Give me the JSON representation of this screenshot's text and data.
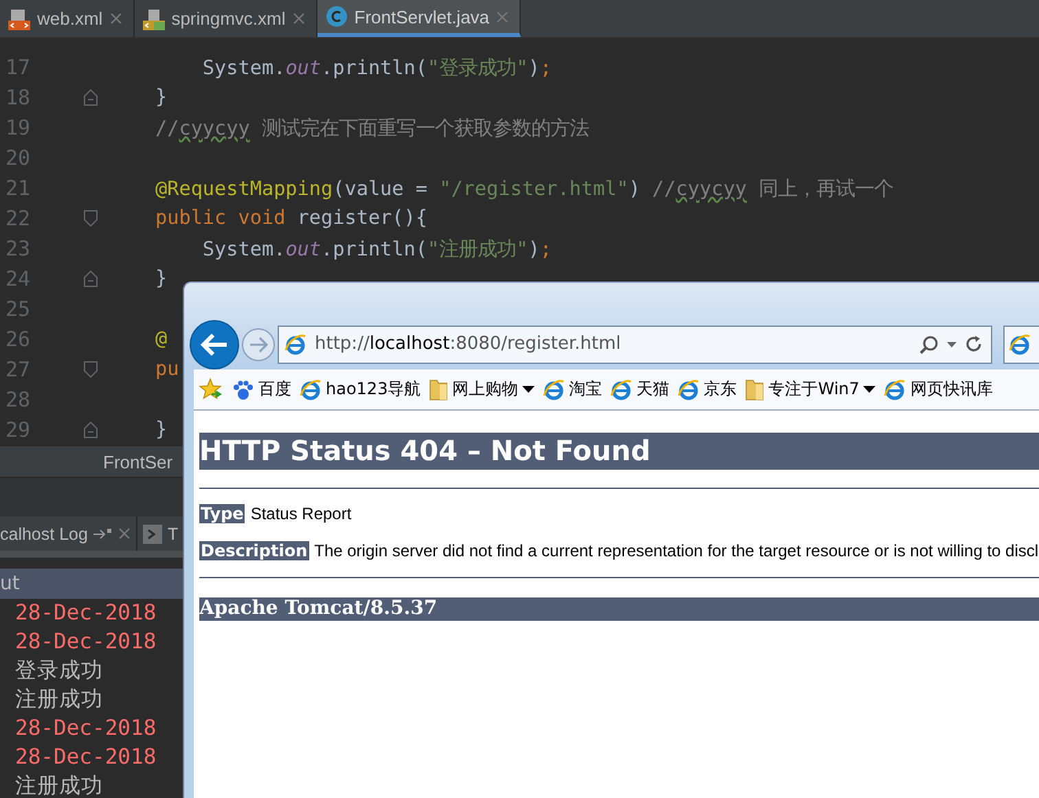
{
  "editor_tabs": [
    {
      "kind": "xml",
      "label": "web.xml",
      "selected": false
    },
    {
      "kind": "spring-xml",
      "label": "springmvc.xml",
      "selected": false
    },
    {
      "kind": "class",
      "label": "FrontServlet.java",
      "selected": true
    }
  ],
  "editor": {
    "lines": [
      {
        "number": "17",
        "kind": "plain",
        "code": [
          {
            "kind": "plain",
            "text": "    System."
          },
          {
            "kind": "static",
            "text": "out"
          },
          {
            "kind": "plain",
            "text": ".println("
          },
          {
            "kind": "string",
            "text": "\"登录成功\""
          },
          {
            "kind": "plain",
            "text": ")"
          },
          {
            "kind": "keyword",
            "text": ";"
          }
        ]
      },
      {
        "number": "18",
        "kind": "fold-end",
        "code": [
          {
            "kind": "plain",
            "text": "}"
          }
        ]
      },
      {
        "number": "19",
        "kind": "plain",
        "code": [
          {
            "kind": "comment",
            "text": "//"
          },
          {
            "kind": "comment-typo",
            "text": "cyycyy"
          },
          {
            "kind": "comment",
            "text": " 测试完在下面重写一个获取参数的方法"
          }
        ]
      },
      {
        "number": "20",
        "kind": "plain"
      },
      {
        "number": "21",
        "kind": "plain",
        "code": [
          {
            "kind": "annotation",
            "text": "@RequestMapping"
          },
          {
            "kind": "plain",
            "text": "(value = "
          },
          {
            "kind": "string",
            "text": "\"/register.html\""
          },
          {
            "kind": "plain",
            "text": ") "
          },
          {
            "kind": "comment",
            "text": "//"
          },
          {
            "kind": "comment-typo",
            "text": "cyycyy"
          },
          {
            "kind": "comment",
            "text": " 同上，再试一个"
          }
        ]
      },
      {
        "number": "22",
        "kind": "fold-start",
        "code": [
          {
            "kind": "keyword",
            "text": "public void "
          },
          {
            "kind": "plain",
            "text": "register(){"
          }
        ]
      },
      {
        "number": "23",
        "kind": "plain",
        "code": [
          {
            "kind": "plain",
            "text": "    System."
          },
          {
            "kind": "static",
            "text": "out"
          },
          {
            "kind": "plain",
            "text": ".println("
          },
          {
            "kind": "string",
            "text": "\"注册成功\""
          },
          {
            "kind": "plain",
            "text": ")"
          },
          {
            "kind": "keyword",
            "text": ";"
          }
        ]
      },
      {
        "number": "24",
        "kind": "fold-end",
        "code": [
          {
            "kind": "plain",
            "text": "}"
          }
        ]
      },
      {
        "number": "25",
        "kind": "plain"
      },
      {
        "number": "26",
        "kind": "plain",
        "code": [
          {
            "kind": "annotation",
            "text": "@"
          }
        ]
      },
      {
        "number": "27",
        "kind": "fold-start",
        "code": [
          {
            "kind": "keyword",
            "text": "pu"
          }
        ]
      },
      {
        "number": "28",
        "kind": "plain"
      },
      {
        "number": "29",
        "kind": "fold-end",
        "code": [
          {
            "kind": "plain",
            "text": "}"
          }
        ]
      }
    ]
  },
  "file_status": {
    "label": "FrontSer"
  },
  "tool_tabs": [
    {
      "label": "calhost Log",
      "selected": true
    },
    {
      "label": "T",
      "selected": false
    }
  ],
  "output_header": {
    "label": "ut"
  },
  "console_lines": [
    {
      "kind": "log",
      "text": "28-Dec-2018"
    },
    {
      "kind": "log",
      "text": "28-Dec-2018"
    },
    {
      "kind": "out",
      "text": "登录成功"
    },
    {
      "kind": "out",
      "text": "注册成功"
    },
    {
      "kind": "log",
      "text": "28-Dec-2018"
    },
    {
      "kind": "log",
      "text": "28-Dec-2018"
    },
    {
      "kind": "out",
      "text": "注册成功"
    }
  ],
  "browser": {
    "address": {
      "prefix": "http://",
      "host": "localhost",
      "rest": ":8080/register.html"
    },
    "favorites": [
      {
        "kind": "baidu",
        "label": "百度",
        "menu": false
      },
      {
        "kind": "page",
        "label": "hao123导航",
        "menu": false
      },
      {
        "kind": "folder",
        "label": "网上购物",
        "menu": true
      },
      {
        "kind": "page",
        "label": "淘宝",
        "menu": false
      },
      {
        "kind": "page",
        "label": "天猫",
        "menu": false
      },
      {
        "kind": "page",
        "label": "京东",
        "menu": false
      },
      {
        "kind": "folder",
        "label": "专注于Win7",
        "menu": true
      },
      {
        "kind": "page",
        "label": "网页快讯库",
        "menu": false
      }
    ],
    "page": {
      "title": "HTTP Status 404 – Not Found",
      "fields": [
        {
          "label": "Type",
          "value": "Status Report"
        },
        {
          "label": "Description",
          "value": "The origin server did not find a current representation for the target resource or is not willing to discl"
        }
      ],
      "footer": "Apache Tomcat/8.5.37"
    }
  }
}
